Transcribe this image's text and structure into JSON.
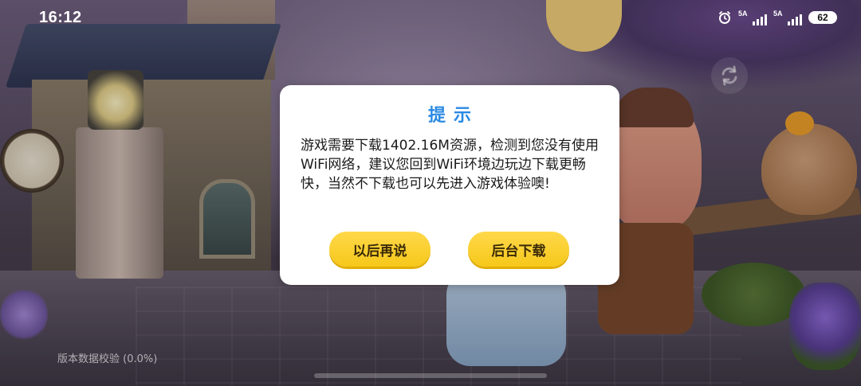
{
  "status_bar": {
    "time": "16:12",
    "signal_1_label": "5A",
    "signal_2_label": "5A",
    "battery": "62",
    "icons": [
      "alarm-icon",
      "signal-icon",
      "signal-icon",
      "battery-icon"
    ]
  },
  "dialog": {
    "title": "提示",
    "message": "游戏需要下载1402.16M资源，检测到您没有使用WiFi网络，建议您回到WiFi环境边玩边下载更畅快，当然不下载也可以先进入游戏体验噢!",
    "later_button": "以后再说",
    "background_download_button": "后台下载"
  },
  "footer": {
    "verify_text": "版本数据校验 (0.0%)",
    "progress": 0.0
  },
  "colors": {
    "title": "#2a8ae3",
    "button": "#f6c81a"
  },
  "refresh_icon": "refresh-icon"
}
